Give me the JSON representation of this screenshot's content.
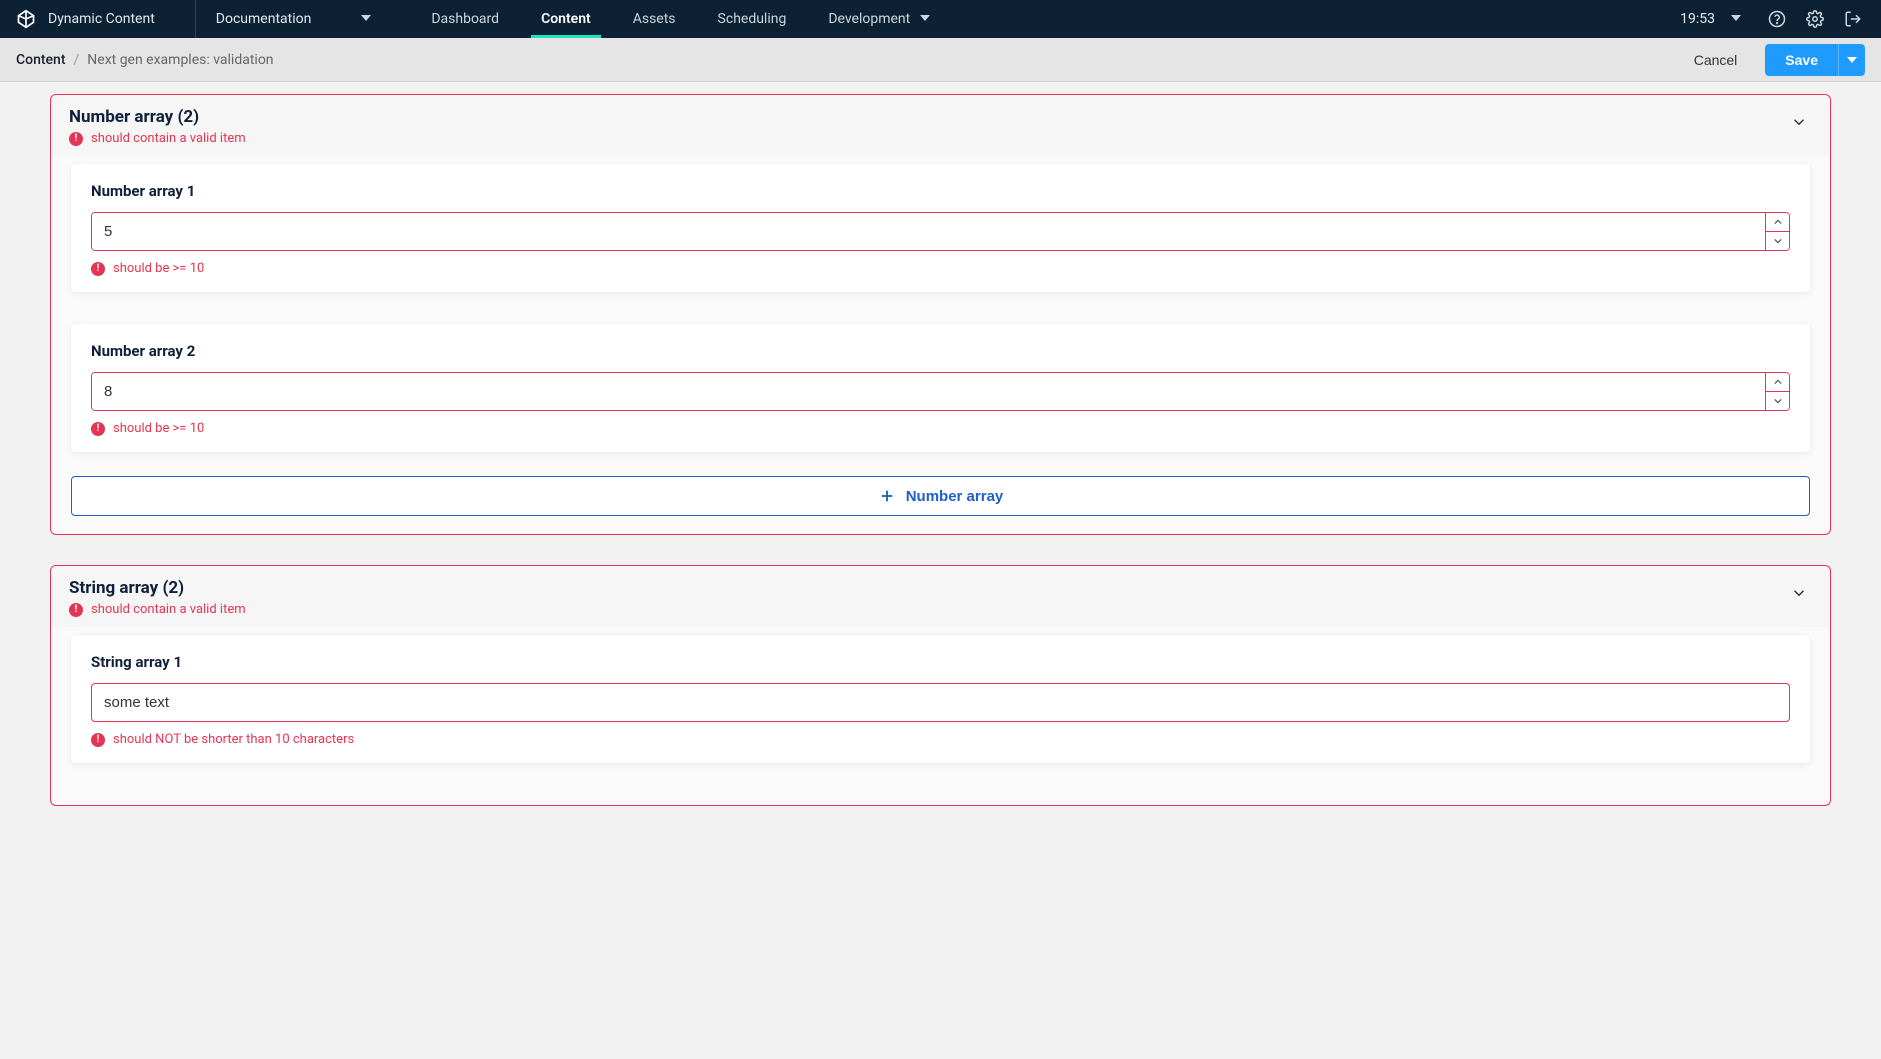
{
  "header": {
    "brand": "Dynamic Content",
    "hub": "Documentation",
    "nav": {
      "dashboard": "Dashboard",
      "content": "Content",
      "assets": "Assets",
      "scheduling": "Scheduling",
      "development": "Development"
    },
    "time": "19:53"
  },
  "subheader": {
    "breadcrumb_root": "Content",
    "breadcrumb_current": "Next gen examples: validation",
    "cancel": "Cancel",
    "save": "Save"
  },
  "panels": {
    "number_array": {
      "title": "Number array (2)",
      "error": "should contain a valid item",
      "items": [
        {
          "label": "Number array 1",
          "value": "5",
          "error": "should be >= 10"
        },
        {
          "label": "Number array 2",
          "value": "8",
          "error": "should be >= 10"
        }
      ],
      "add_label": "Number array"
    },
    "string_array": {
      "title": "String array (2)",
      "error": "should contain a valid item",
      "items": [
        {
          "label": "String array 1",
          "value": "some text",
          "error": "should NOT be shorter than 10 characters"
        }
      ]
    }
  }
}
